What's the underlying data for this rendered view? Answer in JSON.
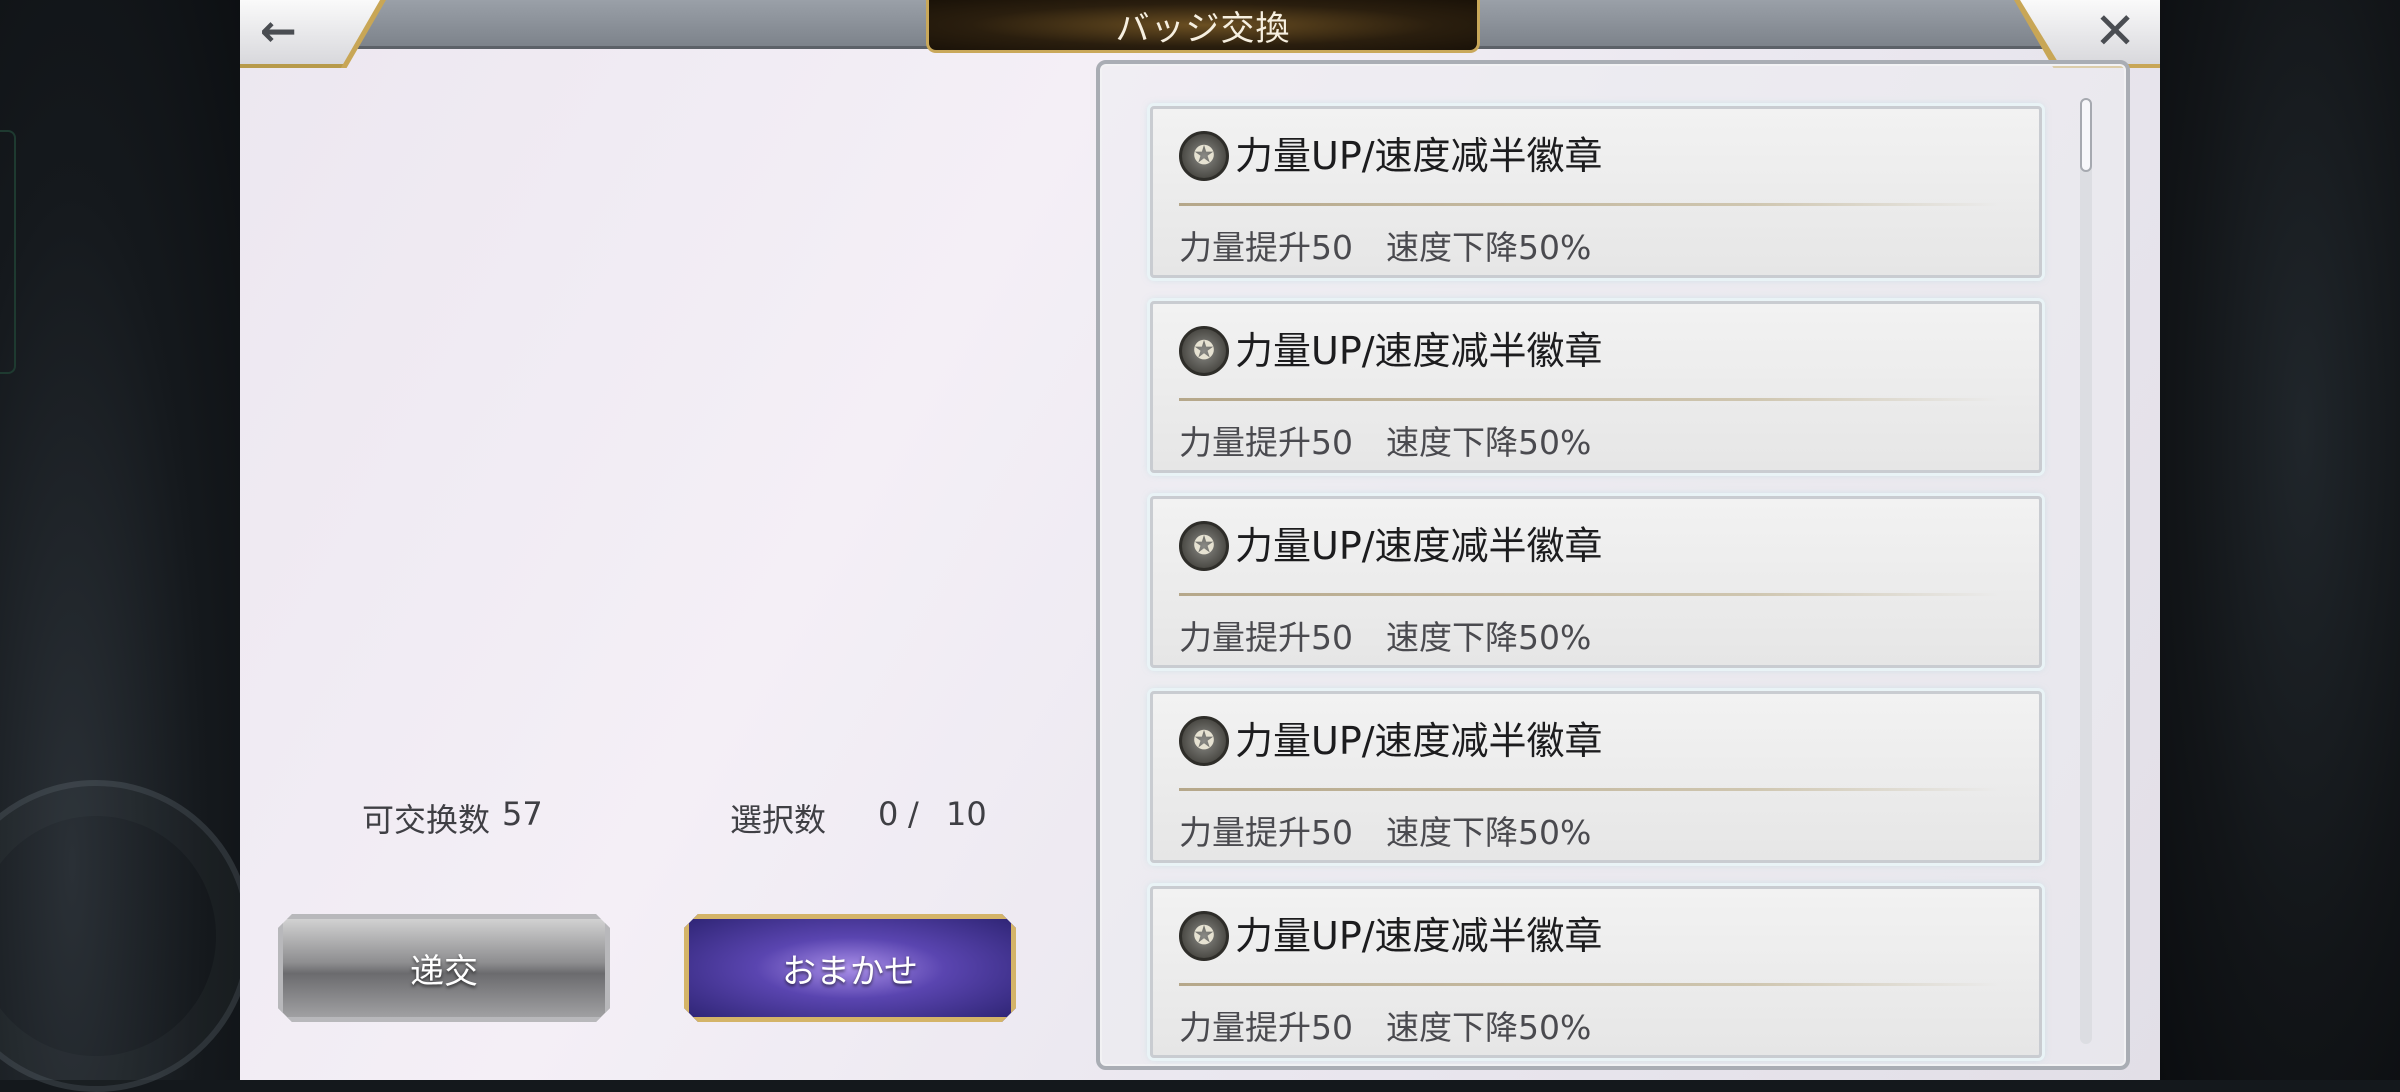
{
  "header": {
    "title": "バッジ交換",
    "back_icon": "←",
    "close_icon": "✕"
  },
  "summary": {
    "exchangeable_label": "可交换数",
    "exchangeable_value": "57",
    "selected_label": "選択数",
    "selected_current": "0",
    "slash": "/",
    "selected_max": "10"
  },
  "buttons": {
    "trade_label": "递交",
    "auto_label": "おまかせ"
  },
  "badges": {
    "icon": "✪",
    "items": [
      {
        "title": "力量UP/速度减半徽章",
        "desc": "力量提升50　速度下降50%"
      },
      {
        "title": "力量UP/速度减半徽章",
        "desc": "力量提升50　速度下降50%"
      },
      {
        "title": "力量UP/速度减半徽章",
        "desc": "力量提升50　速度下降50%"
      },
      {
        "title": "力量UP/速度减半徽章",
        "desc": "力量提升50　速度下降50%"
      },
      {
        "title": "力量UP/速度减半徽章",
        "desc": "力量提升50　速度下降50%"
      }
    ]
  }
}
